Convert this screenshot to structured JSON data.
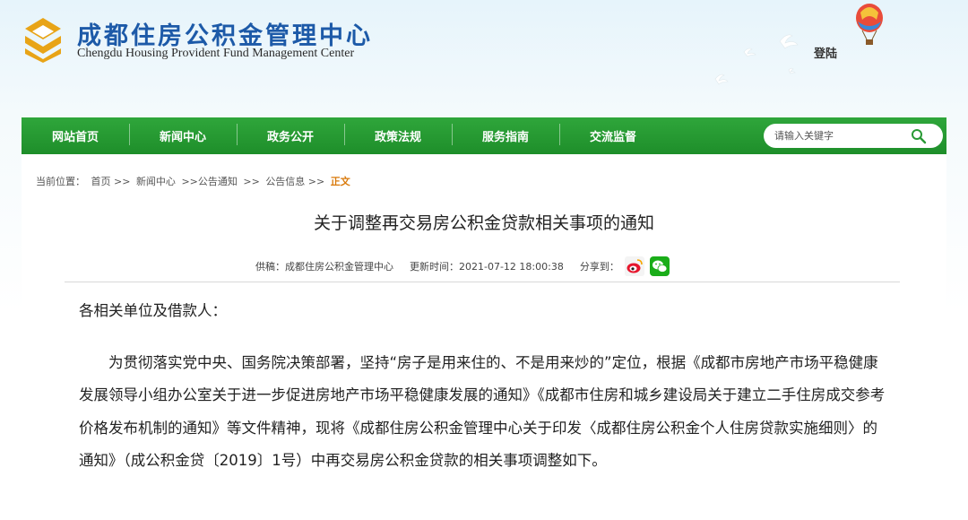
{
  "header": {
    "title_cn": "成都住房公积金管理中心",
    "title_en": "Chengdu Housing Provident Fund Management Center",
    "login_label": "登陆"
  },
  "nav": {
    "items": [
      {
        "label": "网站首页"
      },
      {
        "label": "新闻中心"
      },
      {
        "label": "政务公开"
      },
      {
        "label": "政策法规"
      },
      {
        "label": "服务指南"
      },
      {
        "label": "交流监督"
      }
    ],
    "search_placeholder": "请输入关键字"
  },
  "breadcrumb": {
    "prefix": "当前位置：",
    "items": [
      "首页 >>",
      "新闻中心",
      ">>公告通知",
      ">>",
      "公告信息 >>"
    ],
    "current": "正文"
  },
  "article": {
    "title": "关于调整再交易房公积金贷款相关事项的通知",
    "source": "供稿：成都住房公积金管理中心",
    "updated": "更新时间：2021-07-12 18:00:38",
    "share_label": "分享到：",
    "salutation": "各相关单位及借款人：",
    "paragraph": "为贯彻落实党中央、国务院决策部署，坚持“房子是用来住的、不是用来炒的”定位，根据《成都市房地产市场平稳健康发展领导小组办公室关于进一步促进房地产市场平稳健康发展的通知》《成都市住房和城乡建设局关于建立二手住房成交参考价格发布机制的通知》等文件精神，现将《成都住房公积金管理中心关于印发〈成都住房公积金个人住房贷款实施细则〉的通知》（成公积金贷〔2019〕1号）中再交易房公积金贷款的相关事项调整如下。"
  },
  "icons": {
    "logo": "logo-icon",
    "balloon": "balloon-icon",
    "doves": "doves-icon",
    "search": "search-icon",
    "weibo": "weibo-icon",
    "wechat": "wechat-icon"
  },
  "colors": {
    "nav_green": "#22992f",
    "title_blue": "#1d5aa8",
    "breadcrumb_current": "#d97a0c"
  }
}
